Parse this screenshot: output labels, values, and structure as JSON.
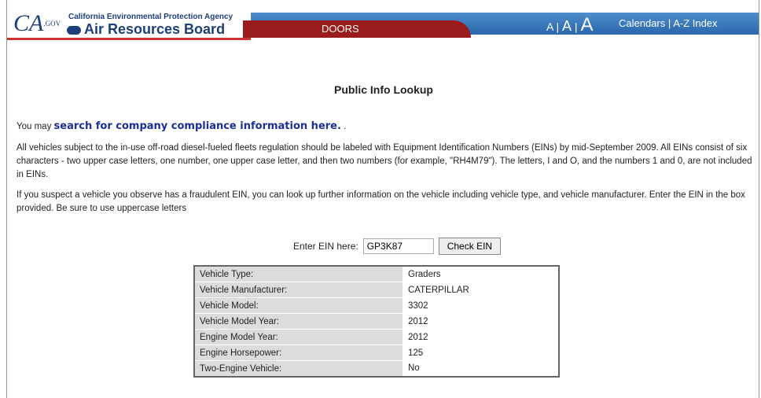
{
  "header": {
    "logo_text": "CA",
    "logo_sub": ".GOV",
    "agency": "California Environmental Protection Agency",
    "board": "Air Resources Board",
    "tab": "DOORS",
    "text_size_small": "A",
    "text_size_medium": "A",
    "text_size_large": "A",
    "link_calendars": "Calendars",
    "separator": "|",
    "link_az": "A-Z Index"
  },
  "main": {
    "title": "Public Info Lookup",
    "intro_prefix": "You may ",
    "intro_link": "search for company compliance information here.",
    "intro_suffix": " .",
    "para1": "All vehicles subject to the in-use off-road diesel-fueled fleets regulation should be labeled with Equipment Identification Numbers (EINs) by mid-September 2009. All EINs consist of six characters - two upper case letters, one number, one upper case letter, and then two numbers (for example, \"RH4M79\"). The letters, I and O, and the numbers 1 and 0, are not included in EINs.",
    "para2": "If you suspect a vehicle you observe has a fraudulent EIN, you can look up further information on the vehicle including vehicle type, and vehicle manufacturer. Enter the EIN in the box provided. Be sure to use uppercase letters",
    "ein_label": "Enter EIN here:",
    "ein_value": "GP3K87",
    "check_button": "Check EIN"
  },
  "results": [
    {
      "label": "Vehicle Type:",
      "value": "Graders"
    },
    {
      "label": "Vehicle Manufacturer:",
      "value": "CATERPILLAR"
    },
    {
      "label": "Vehicle Model:",
      "value": "3302"
    },
    {
      "label": "Vehicle Model Year:",
      "value": "2012"
    },
    {
      "label": "Engine Model Year:",
      "value": "2012"
    },
    {
      "label": "Engine Horsepower:",
      "value": "125"
    },
    {
      "label": "Two-Engine Vehicle:",
      "value": "No"
    }
  ]
}
